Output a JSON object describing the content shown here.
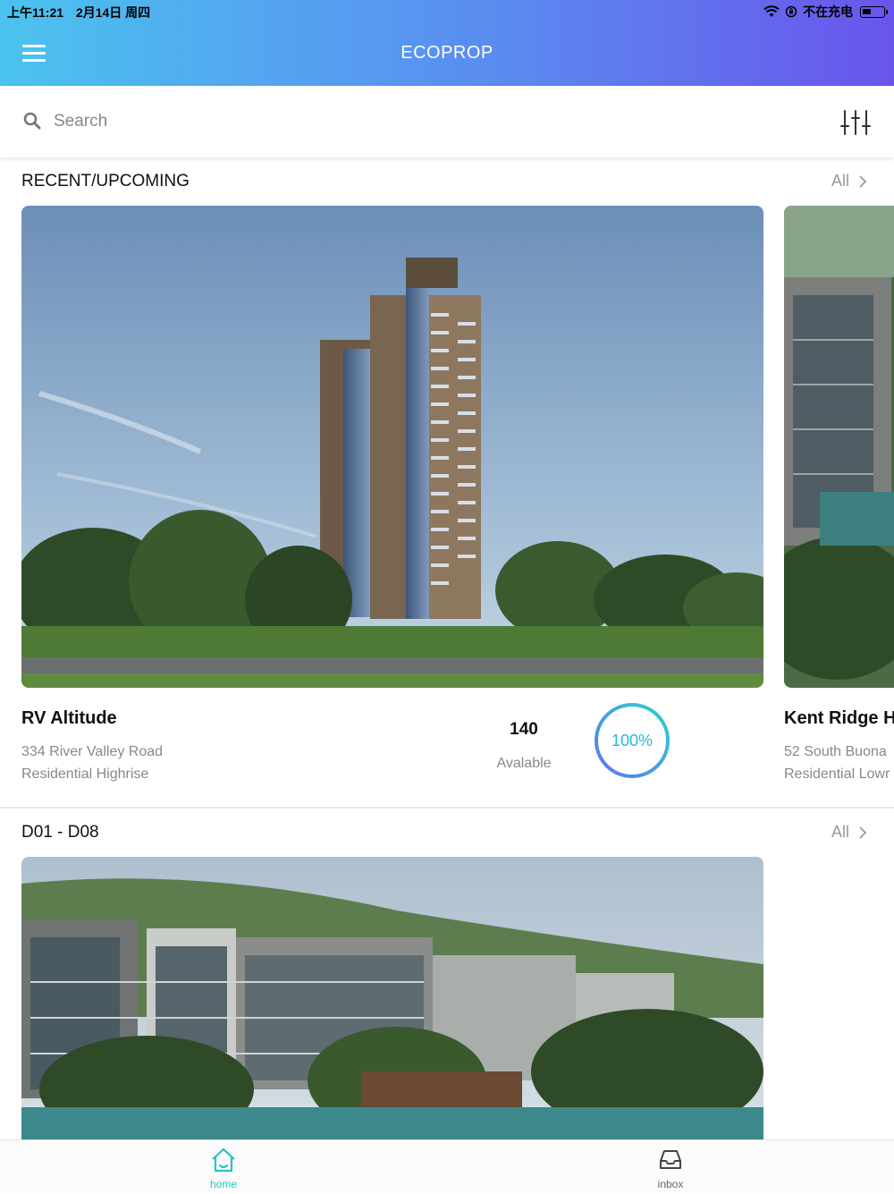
{
  "status_bar": {
    "time": "上午11:21",
    "date": "2月14日 周四",
    "charging": "不在充电"
  },
  "header": {
    "title": "ECOPROP"
  },
  "search": {
    "placeholder": "Search"
  },
  "sections": [
    {
      "title": "RECENT/UPCOMING",
      "all_label": "All",
      "cards": [
        {
          "name": "RV Altitude",
          "address": "334 River Valley Road",
          "type": "Residential Highrise",
          "count": "140",
          "count_label": "Avalable",
          "progress_text": "100%",
          "progress": 1.0
        },
        {
          "name": "Kent Ridge H",
          "address": "52 South Buona",
          "type": "Residential Lowr"
        }
      ]
    },
    {
      "title": "D01 - D08",
      "all_label": "All"
    }
  ],
  "tabs": [
    {
      "label": "home",
      "icon": "home-icon",
      "active": true
    },
    {
      "label": "inbox",
      "icon": "inbox-icon",
      "active": false
    }
  ],
  "colors": {
    "header_gradient": [
      "#4bc3ee",
      "#5a8cf0",
      "#6a55ec"
    ],
    "accent": "#25c4c4",
    "progress_ring": "#29b8d9"
  }
}
